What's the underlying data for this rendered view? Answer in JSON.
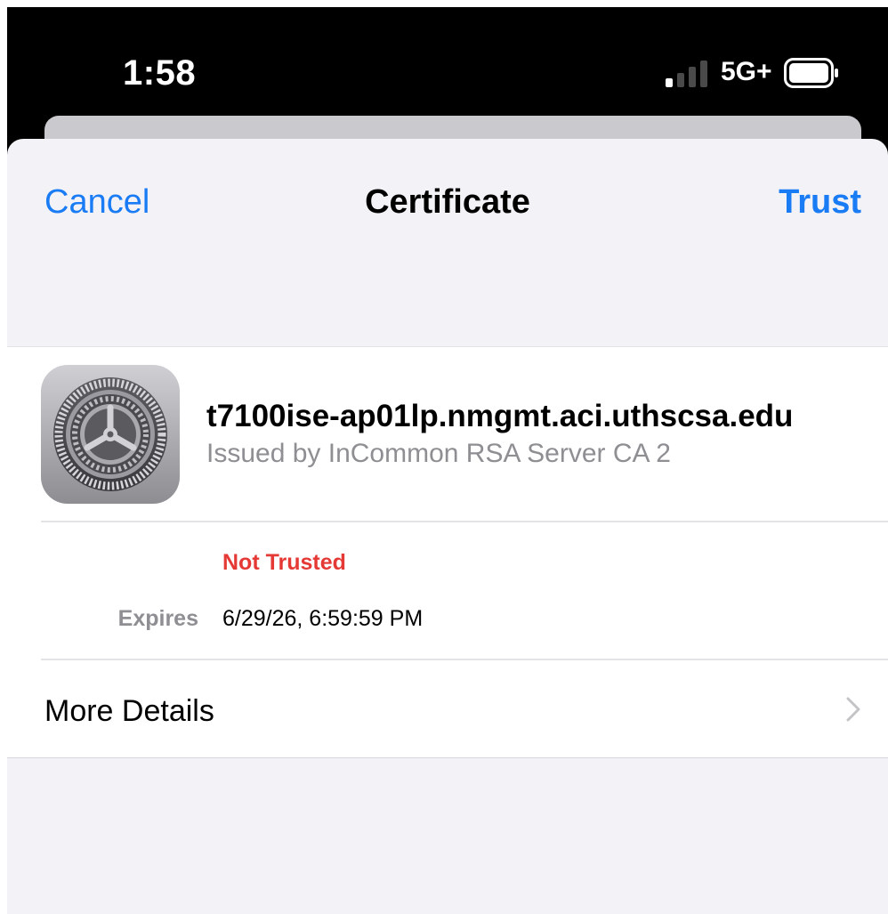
{
  "status_bar": {
    "time": "1:58",
    "network": "5G+",
    "signal_icon": "signal-bars-icon",
    "battery_icon": "battery-icon"
  },
  "nav": {
    "cancel_label": "Cancel",
    "title": "Certificate",
    "trust_label": "Trust"
  },
  "certificate": {
    "icon": "settings-gear-icon",
    "name": "t7100ise-ap01lp.nmgmt.aci.uthscsa.edu",
    "issuer": "Issued by InCommon RSA Server CA 2",
    "trust_status": "Not Trusted",
    "expires_label": "Expires",
    "expires_value": "6/29/26, 6:59:59 PM"
  },
  "more_details": {
    "label": "More Details",
    "icon": "chevron-right-icon"
  },
  "colors": {
    "accent": "#1a7cf5",
    "danger": "#e53935",
    "secondary_text": "#8e8e93",
    "sheet_background": "#f2f2f7"
  }
}
